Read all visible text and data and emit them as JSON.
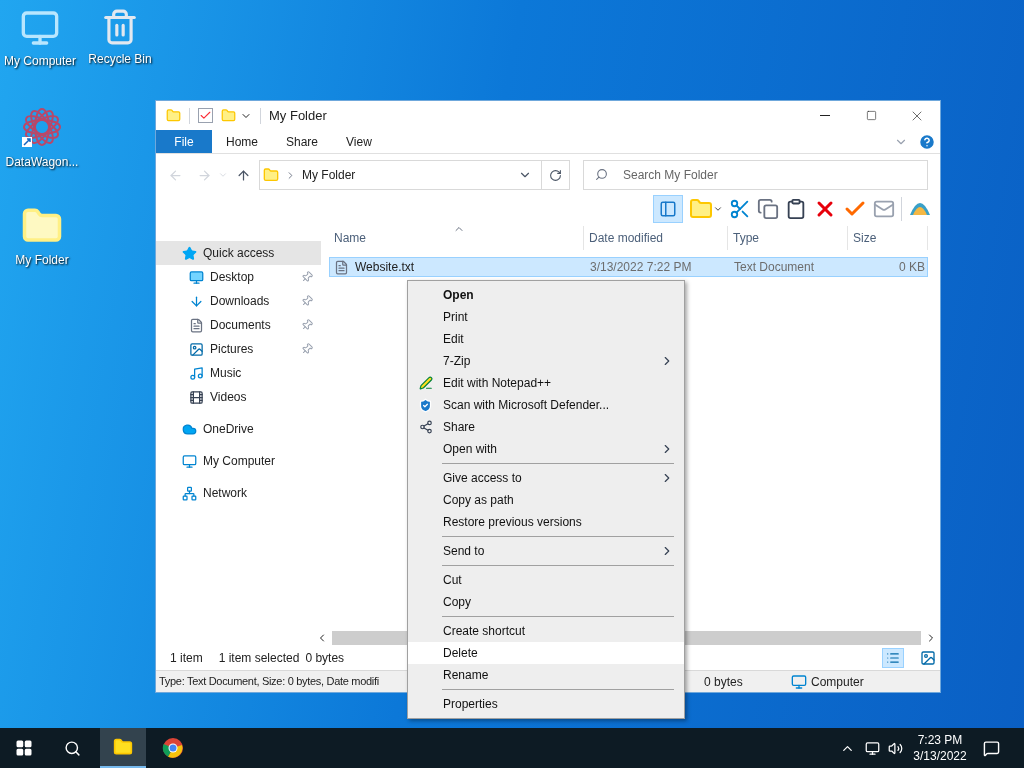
{
  "desktop_icons": [
    {
      "label": "My Computer"
    },
    {
      "label": "Recycle Bin"
    },
    {
      "label": "DataWagon..."
    },
    {
      "label": "My Folder"
    }
  ],
  "window": {
    "title": "My Folder",
    "ribbon_tabs": [
      {
        "label": "File",
        "kind": "file"
      },
      {
        "label": "Home",
        "kind": "tab"
      },
      {
        "label": "Share",
        "kind": "tab"
      },
      {
        "label": "View",
        "kind": "tab"
      }
    ],
    "address": {
      "path": "My Folder"
    },
    "search": {
      "placeholder": "Search My Folder"
    },
    "sidebar": [
      {
        "label": "Quick access",
        "selected": true,
        "children": [
          {
            "label": "Desktop",
            "pinned": true,
            "selected": false
          },
          {
            "label": "Downloads",
            "pinned": true,
            "selected": false
          },
          {
            "label": "Documents",
            "pinned": true,
            "selected": false
          },
          {
            "label": "Pictures",
            "pinned": true,
            "selected": false
          },
          {
            "label": "Music",
            "pinned": false,
            "selected": false
          },
          {
            "label": "Videos",
            "pinned": false,
            "selected": false
          }
        ]
      },
      {
        "label": "OneDrive",
        "selected": false
      },
      {
        "label": "My Computer",
        "selected": false
      },
      {
        "label": "Network",
        "selected": false
      }
    ],
    "columns": [
      "Name",
      "Date modified",
      "Type",
      "Size"
    ],
    "files": [
      {
        "name": "Website.txt",
        "date": "3/13/2022 7:22 PM",
        "type": "Text Document",
        "size": "0 KB",
        "selected": true
      }
    ],
    "status": {
      "count": "1 item",
      "selection": "1 item selected",
      "size": "0 bytes"
    },
    "details_bar": {
      "info": "Type: Text Document, Size: 0 bytes, Date modifi",
      "size": "0 bytes",
      "location": "Computer"
    }
  },
  "context_menu": [
    {
      "kind": "item",
      "label": "Open",
      "default": true,
      "submenu": false,
      "selected": false
    },
    {
      "kind": "item",
      "label": "Print",
      "default": false,
      "submenu": false,
      "selected": false
    },
    {
      "kind": "item",
      "label": "Edit",
      "default": false,
      "submenu": false,
      "selected": false
    },
    {
      "kind": "item",
      "label": "7-Zip",
      "default": false,
      "submenu": true,
      "selected": false
    },
    {
      "kind": "item",
      "label": "Edit with Notepad++",
      "default": false,
      "submenu": false,
      "selected": false
    },
    {
      "kind": "item",
      "label": "Scan with Microsoft Defender...",
      "default": false,
      "submenu": false,
      "selected": false
    },
    {
      "kind": "item",
      "label": "Share",
      "default": false,
      "submenu": false,
      "selected": false
    },
    {
      "kind": "item",
      "label": "Open with",
      "default": false,
      "submenu": true,
      "selected": false
    },
    {
      "kind": "separator"
    },
    {
      "kind": "item",
      "label": "Give access to",
      "default": false,
      "submenu": true,
      "selected": false
    },
    {
      "kind": "item",
      "label": "Copy as path",
      "default": false,
      "submenu": false,
      "selected": false
    },
    {
      "kind": "item",
      "label": "Restore previous versions",
      "default": false,
      "submenu": false,
      "selected": false
    },
    {
      "kind": "separator"
    },
    {
      "kind": "item",
      "label": "Send to",
      "default": false,
      "submenu": true,
      "selected": false
    },
    {
      "kind": "separator"
    },
    {
      "kind": "item",
      "label": "Cut",
      "default": false,
      "submenu": false,
      "selected": false
    },
    {
      "kind": "item",
      "label": "Copy",
      "default": false,
      "submenu": false,
      "selected": false
    },
    {
      "kind": "separator"
    },
    {
      "kind": "item",
      "label": "Create shortcut",
      "default": false,
      "submenu": false,
      "selected": false
    },
    {
      "kind": "item",
      "label": "Delete",
      "default": false,
      "submenu": false,
      "selected": true
    },
    {
      "kind": "item",
      "label": "Rename",
      "default": false,
      "submenu": false,
      "selected": false
    },
    {
      "kind": "separator"
    },
    {
      "kind": "item",
      "label": "Properties",
      "default": false,
      "submenu": false,
      "selected": false
    }
  ],
  "taskbar": {
    "apps": [
      {
        "selected": true
      },
      {
        "selected": false
      }
    ],
    "time": "7:23 PM",
    "date": "3/13/2022"
  }
}
